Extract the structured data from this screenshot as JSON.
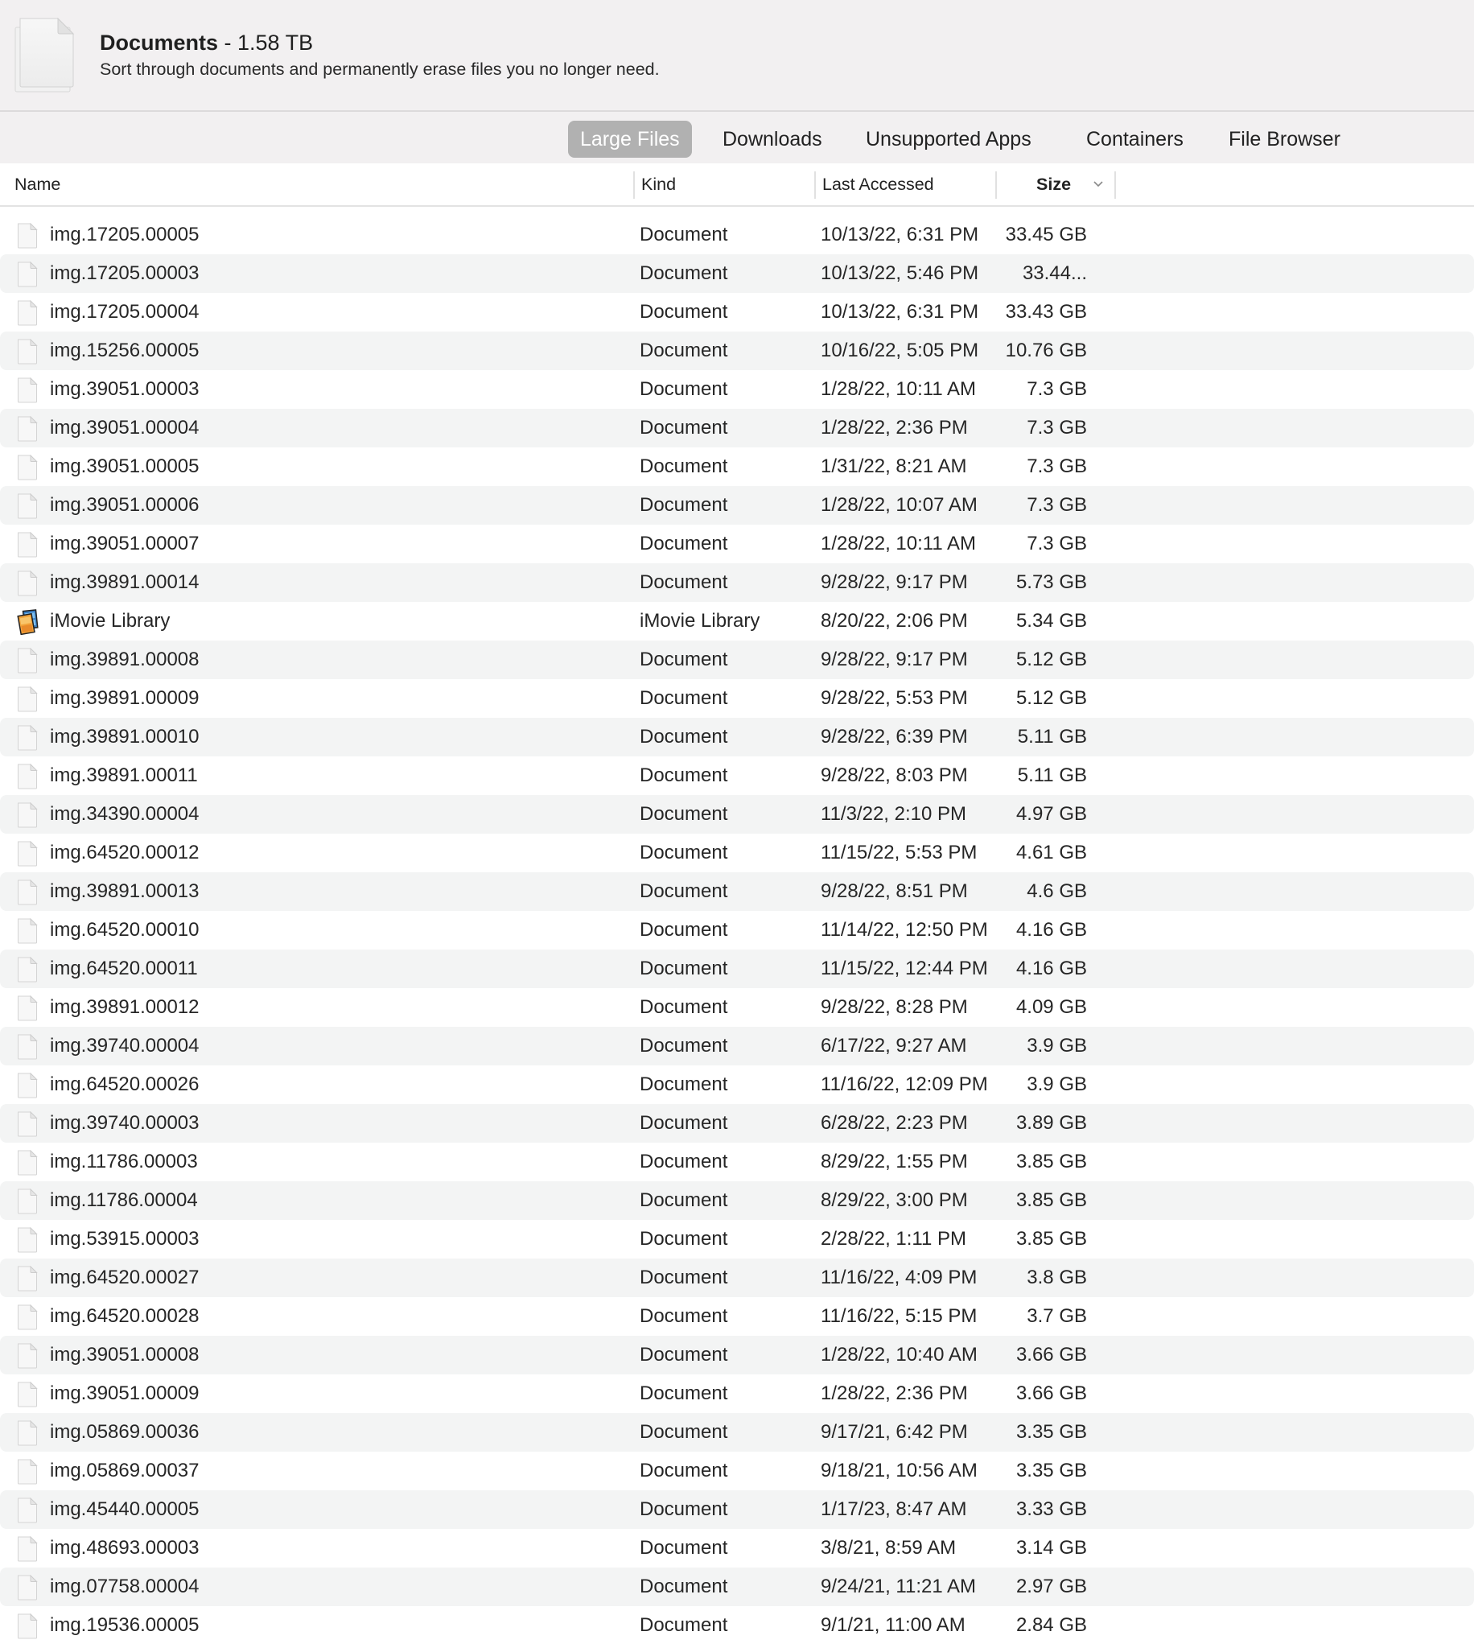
{
  "header": {
    "title": "Documents",
    "title_suffix": " - 1.58 TB",
    "subtitle": "Sort through documents and permanently erase files you no longer need.",
    "icon": "documents-icon"
  },
  "tabs": [
    {
      "label": "Large Files",
      "active": true
    },
    {
      "label": "Downloads",
      "active": false
    },
    {
      "label": "Unsupported Apps",
      "active": false
    },
    {
      "label": "Containers",
      "active": false
    },
    {
      "label": "File Browser",
      "active": false
    }
  ],
  "columns": {
    "name": "Name",
    "kind": "Kind",
    "last_accessed": "Last Accessed",
    "size": "Size",
    "sort_column": "size",
    "sort_icon": "chevron-down-icon"
  },
  "rows": [
    {
      "name": "img.17205.00005",
      "kind": "Document",
      "accessed": "10/13/22, 6:31 PM",
      "size": "33.45 GB",
      "icon": "document-icon"
    },
    {
      "name": "img.17205.00003",
      "kind": "Document",
      "accessed": "10/13/22, 5:46 PM",
      "size": "33.44...",
      "icon": "document-icon"
    },
    {
      "name": "img.17205.00004",
      "kind": "Document",
      "accessed": "10/13/22, 6:31 PM",
      "size": "33.43 GB",
      "icon": "document-icon"
    },
    {
      "name": "img.15256.00005",
      "kind": "Document",
      "accessed": "10/16/22, 5:05 PM",
      "size": "10.76 GB",
      "icon": "document-icon"
    },
    {
      "name": "img.39051.00003",
      "kind": "Document",
      "accessed": "1/28/22, 10:11 AM",
      "size": "7.3 GB",
      "icon": "document-icon"
    },
    {
      "name": "img.39051.00004",
      "kind": "Document",
      "accessed": "1/28/22, 2:36 PM",
      "size": "7.3 GB",
      "icon": "document-icon"
    },
    {
      "name": "img.39051.00005",
      "kind": "Document",
      "accessed": "1/31/22, 8:21 AM",
      "size": "7.3 GB",
      "icon": "document-icon"
    },
    {
      "name": "img.39051.00006",
      "kind": "Document",
      "accessed": "1/28/22, 10:07 AM",
      "size": "7.3 GB",
      "icon": "document-icon"
    },
    {
      "name": "img.39051.00007",
      "kind": "Document",
      "accessed": "1/28/22, 10:11 AM",
      "size": "7.3 GB",
      "icon": "document-icon"
    },
    {
      "name": "img.39891.00014",
      "kind": "Document",
      "accessed": "9/28/22, 9:17 PM",
      "size": "5.73 GB",
      "icon": "document-icon"
    },
    {
      "name": "iMovie Library",
      "kind": "iMovie Library",
      "accessed": "8/20/22, 2:06 PM",
      "size": "5.34 GB",
      "icon": "imovie-library-icon"
    },
    {
      "name": "img.39891.00008",
      "kind": "Document",
      "accessed": "9/28/22, 9:17 PM",
      "size": "5.12 GB",
      "icon": "document-icon"
    },
    {
      "name": "img.39891.00009",
      "kind": "Document",
      "accessed": "9/28/22, 5:53 PM",
      "size": "5.12 GB",
      "icon": "document-icon"
    },
    {
      "name": "img.39891.00010",
      "kind": "Document",
      "accessed": "9/28/22, 6:39 PM",
      "size": "5.11 GB",
      "icon": "document-icon"
    },
    {
      "name": "img.39891.00011",
      "kind": "Document",
      "accessed": "9/28/22, 8:03 PM",
      "size": "5.11 GB",
      "icon": "document-icon"
    },
    {
      "name": "img.34390.00004",
      "kind": "Document",
      "accessed": "11/3/22, 2:10 PM",
      "size": "4.97 GB",
      "icon": "document-icon"
    },
    {
      "name": "img.64520.00012",
      "kind": "Document",
      "accessed": "11/15/22, 5:53 PM",
      "size": "4.61 GB",
      "icon": "document-icon"
    },
    {
      "name": "img.39891.00013",
      "kind": "Document",
      "accessed": "9/28/22, 8:51 PM",
      "size": "4.6 GB",
      "icon": "document-icon"
    },
    {
      "name": "img.64520.00010",
      "kind": "Document",
      "accessed": "11/14/22, 12:50 PM",
      "size": "4.16 GB",
      "icon": "document-icon"
    },
    {
      "name": "img.64520.00011",
      "kind": "Document",
      "accessed": "11/15/22, 12:44 PM",
      "size": "4.16 GB",
      "icon": "document-icon"
    },
    {
      "name": "img.39891.00012",
      "kind": "Document",
      "accessed": "9/28/22, 8:28 PM",
      "size": "4.09 GB",
      "icon": "document-icon"
    },
    {
      "name": "img.39740.00004",
      "kind": "Document",
      "accessed": "6/17/22, 9:27 AM",
      "size": "3.9 GB",
      "icon": "document-icon"
    },
    {
      "name": "img.64520.00026",
      "kind": "Document",
      "accessed": "11/16/22, 12:09 PM",
      "size": "3.9 GB",
      "icon": "document-icon"
    },
    {
      "name": "img.39740.00003",
      "kind": "Document",
      "accessed": "6/28/22, 2:23 PM",
      "size": "3.89 GB",
      "icon": "document-icon"
    },
    {
      "name": "img.11786.00003",
      "kind": "Document",
      "accessed": "8/29/22, 1:55 PM",
      "size": "3.85 GB",
      "icon": "document-icon"
    },
    {
      "name": "img.11786.00004",
      "kind": "Document",
      "accessed": "8/29/22, 3:00 PM",
      "size": "3.85 GB",
      "icon": "document-icon"
    },
    {
      "name": "img.53915.00003",
      "kind": "Document",
      "accessed": "2/28/22, 1:11 PM",
      "size": "3.85 GB",
      "icon": "document-icon"
    },
    {
      "name": "img.64520.00027",
      "kind": "Document",
      "accessed": "11/16/22, 4:09 PM",
      "size": "3.8 GB",
      "icon": "document-icon"
    },
    {
      "name": "img.64520.00028",
      "kind": "Document",
      "accessed": "11/16/22, 5:15 PM",
      "size": "3.7 GB",
      "icon": "document-icon"
    },
    {
      "name": "img.39051.00008",
      "kind": "Document",
      "accessed": "1/28/22, 10:40 AM",
      "size": "3.66 GB",
      "icon": "document-icon"
    },
    {
      "name": "img.39051.00009",
      "kind": "Document",
      "accessed": "1/28/22, 2:36 PM",
      "size": "3.66 GB",
      "icon": "document-icon"
    },
    {
      "name": "img.05869.00036",
      "kind": "Document",
      "accessed": "9/17/21, 6:42 PM",
      "size": "3.35 GB",
      "icon": "document-icon"
    },
    {
      "name": "img.05869.00037",
      "kind": "Document",
      "accessed": "9/18/21, 10:56 AM",
      "size": "3.35 GB",
      "icon": "document-icon"
    },
    {
      "name": "img.45440.00005",
      "kind": "Document",
      "accessed": "1/17/23, 8:47 AM",
      "size": "3.33 GB",
      "icon": "document-icon"
    },
    {
      "name": "img.48693.00003",
      "kind": "Document",
      "accessed": "3/8/21, 8:59 AM",
      "size": "3.14 GB",
      "icon": "document-icon"
    },
    {
      "name": "img.07758.00004",
      "kind": "Document",
      "accessed": "9/24/21, 11:21 AM",
      "size": "2.97 GB",
      "icon": "document-icon"
    },
    {
      "name": "img.19536.00005",
      "kind": "Document",
      "accessed": "9/1/21, 11:00 AM",
      "size": "2.84 GB",
      "icon": "document-icon"
    }
  ],
  "colors": {
    "header_bg": "#f2f0f1",
    "active_tab_bg": "#b1b1b1",
    "stripe_bg": "#f3f4f4",
    "text": "#262626"
  }
}
